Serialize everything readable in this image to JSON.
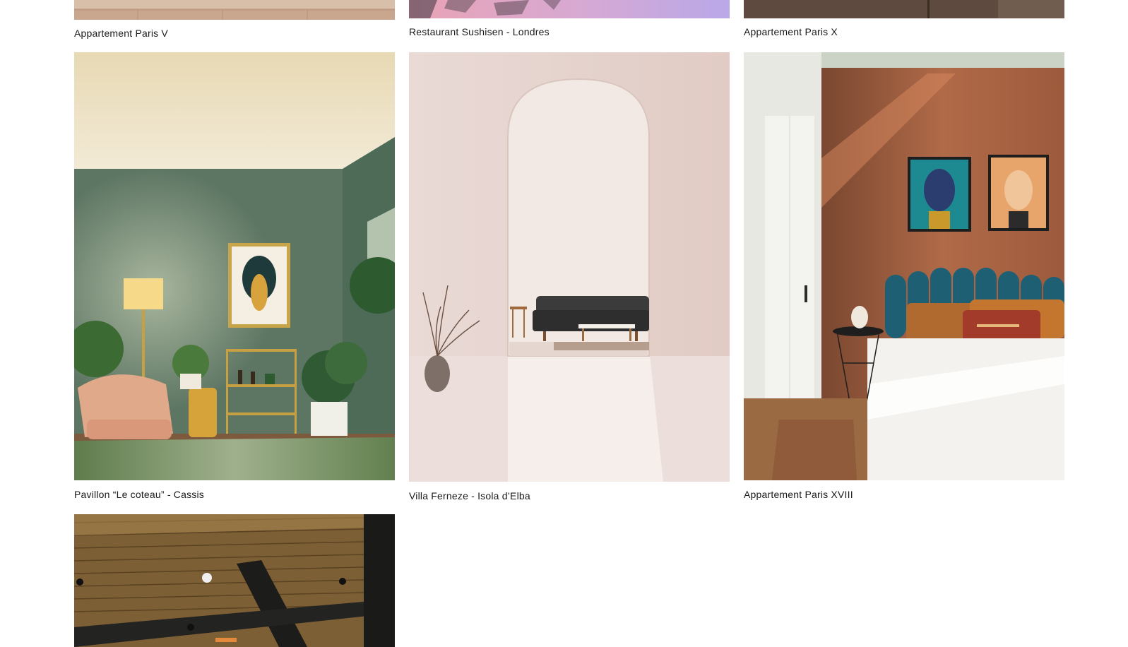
{
  "gallery": {
    "top_row": [
      {
        "caption": "Appartement Paris V"
      },
      {
        "caption": "Restaurant Sushisen - Londres"
      },
      {
        "caption": "Appartement Paris X"
      }
    ],
    "middle_row": [
      {
        "caption": "Pavillon “Le coteau” - Cassis"
      },
      {
        "caption": "Villa Ferneze - Isola d’Elba"
      },
      {
        "caption": "Appartement Paris XVIII"
      }
    ],
    "bottom_row": [
      {
        "caption": ""
      }
    ]
  },
  "colors": {
    "background": "#ffffff",
    "caption_text": "#1a1a1a",
    "green_wall": "#5e7a66",
    "cream_ceiling": "#efe3c6",
    "pink_wall": "#e9d8d2",
    "terracotta_wall": "#a75a3c",
    "wood_ceiling": "#8a6a3e"
  }
}
